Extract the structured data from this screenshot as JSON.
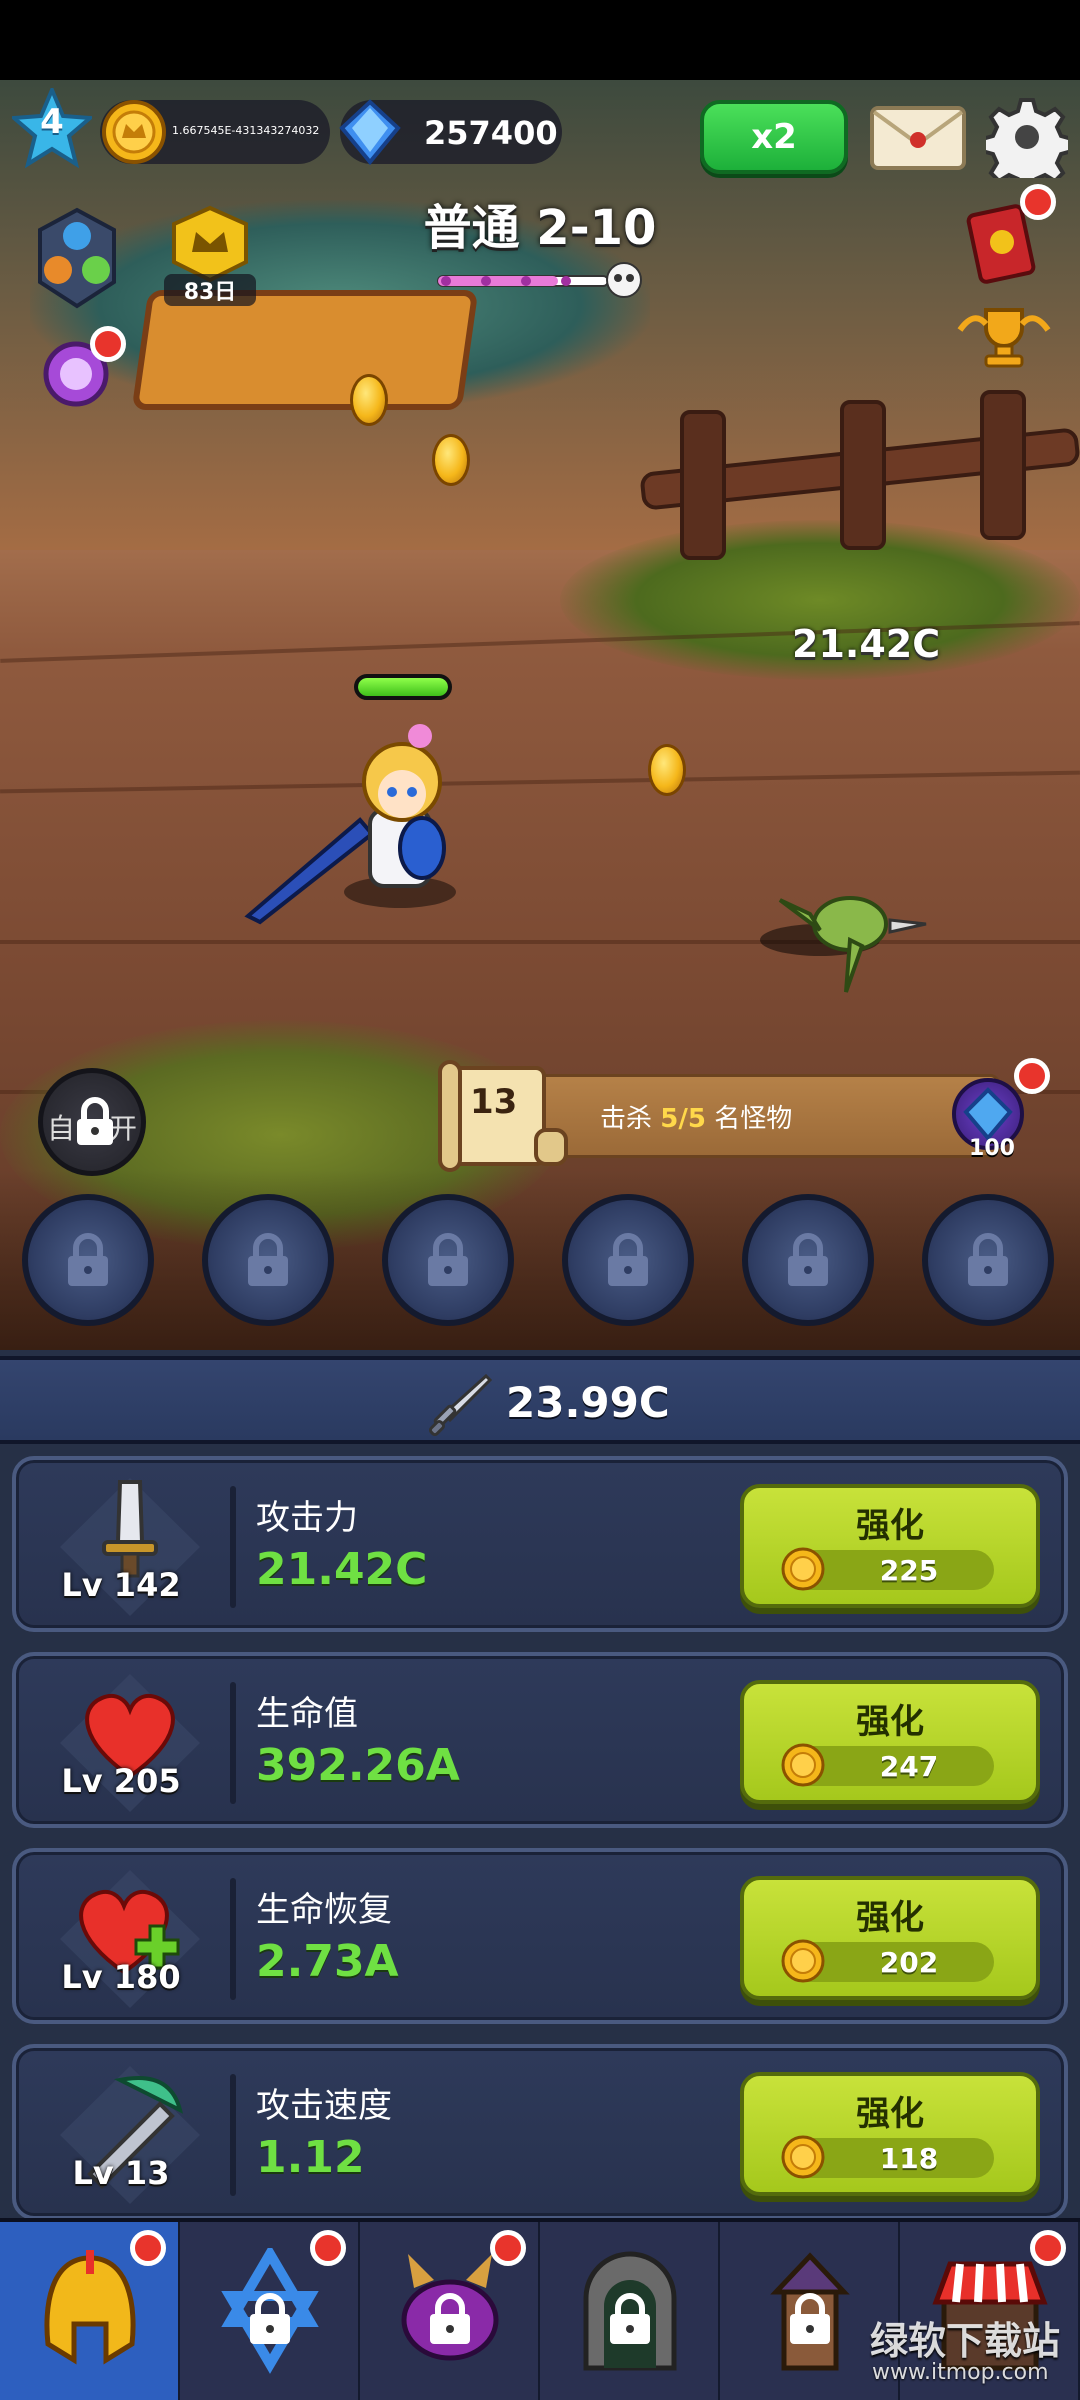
{
  "hud": {
    "level": "4",
    "coins": "1.667545E-431343274032",
    "gems": "257400",
    "speed_label": "x2"
  },
  "stage": {
    "title": "普通 2-10"
  },
  "side": {
    "calendar_days": "83日"
  },
  "battle": {
    "damage_popup": "21.42C",
    "hero_hp_fraction": 1.0
  },
  "auto_toggle": {
    "left_label": "自",
    "right_label": "开"
  },
  "quest": {
    "scroll_number": "13",
    "text_prefix": "击杀 ",
    "text_progress": "5/5",
    "text_suffix": " 名怪物",
    "reward_amount": "100"
  },
  "skill_slots": {
    "count": 6,
    "locked": true
  },
  "dps": "23.99C",
  "stats": [
    {
      "level": "Lv 142",
      "name": "攻击力",
      "value": "21.42C",
      "button": "强化",
      "cost": "225",
      "icon": "sword-icon"
    },
    {
      "level": "Lv 205",
      "name": "生命值",
      "value": "392.26A",
      "button": "强化",
      "cost": "247",
      "icon": "heart-icon"
    },
    {
      "level": "Lv 180",
      "name": "生命恢复",
      "value": "2.73A",
      "button": "强化",
      "cost": "202",
      "icon": "heart-plus-icon"
    },
    {
      "level": "Lv 13",
      "name": "攻击速度",
      "value": "1.12",
      "button": "强化",
      "cost": "118",
      "icon": "pickaxe-icon"
    }
  ],
  "nav": {
    "tabs": [
      {
        "name": "hero",
        "icon": "helmet-icon",
        "active": true,
        "badge": true,
        "locked": false
      },
      {
        "name": "star",
        "icon": "hexagram-icon",
        "active": false,
        "badge": true,
        "locked": true
      },
      {
        "name": "pet",
        "icon": "monster-icon",
        "active": false,
        "badge": true,
        "locked": true
      },
      {
        "name": "dungeon",
        "icon": "gate-icon",
        "active": false,
        "badge": false,
        "locked": true
      },
      {
        "name": "tower",
        "icon": "tower-icon",
        "active": false,
        "badge": false,
        "locked": true
      },
      {
        "name": "shop",
        "icon": "shop-icon",
        "active": false,
        "badge": true,
        "locked": false
      }
    ]
  },
  "watermark": {
    "title": "绿软下载站",
    "url": "www.itmop.com"
  },
  "colors": {
    "accent_green": "#6fe043",
    "upgrade_button": "#b5d42a",
    "panel_bg": "#263046",
    "badge_red": "#e8342c"
  }
}
